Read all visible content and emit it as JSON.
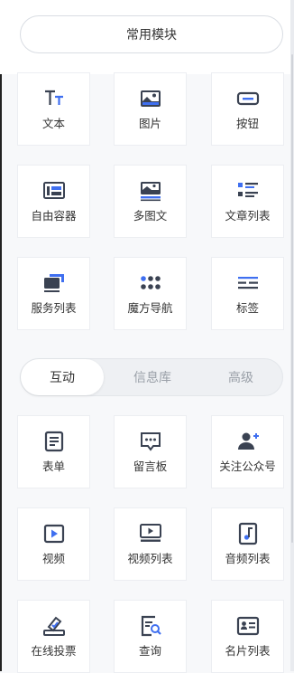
{
  "common_module_button": "常用模块",
  "common_items": [
    {
      "label": "文本",
      "icon": "text-icon"
    },
    {
      "label": "图片",
      "icon": "image-icon"
    },
    {
      "label": "按钮",
      "icon": "button-icon"
    },
    {
      "label": "自由容器",
      "icon": "container-icon"
    },
    {
      "label": "多图文",
      "icon": "multi-image-text-icon"
    },
    {
      "label": "文章列表",
      "icon": "article-list-icon"
    },
    {
      "label": "服务列表",
      "icon": "service-list-icon"
    },
    {
      "label": "魔方导航",
      "icon": "cube-nav-icon"
    },
    {
      "label": "标签",
      "icon": "tag-icon"
    }
  ],
  "tabs": [
    "互动",
    "信息库",
    "高级"
  ],
  "active_tab": "互动",
  "interactive_items": [
    {
      "label": "表单",
      "icon": "form-icon"
    },
    {
      "label": "留言板",
      "icon": "message-board-icon"
    },
    {
      "label": "关注公众号",
      "icon": "follow-account-icon"
    },
    {
      "label": "视频",
      "icon": "video-icon"
    },
    {
      "label": "视频列表",
      "icon": "video-list-icon"
    },
    {
      "label": "音频列表",
      "icon": "audio-list-icon"
    },
    {
      "label": "在线投票",
      "icon": "vote-icon"
    },
    {
      "label": "查询",
      "icon": "query-icon"
    },
    {
      "label": "名片列表",
      "icon": "card-list-icon"
    }
  ],
  "colors": {
    "icon_dark": "#3a4252",
    "icon_accent": "#3f6ff0"
  }
}
